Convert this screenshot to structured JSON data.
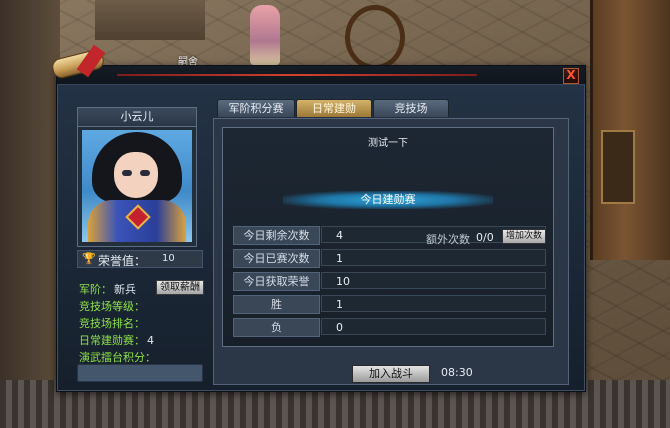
{
  "scene": {
    "npc_name": "嗣舍"
  },
  "window": {
    "close_label": "X"
  },
  "character": {
    "name": "小云儿",
    "honor_label": "荣誉值：",
    "honor_value": "10",
    "rank_label": "军阶：",
    "rank_value": "新兵",
    "claim_label": "领取薪酬",
    "arena_level_label": "竞技场等级：",
    "arena_rank_label": "竞技场排名：",
    "daily_label": "日常建勋赛：",
    "daily_value": "4",
    "drill_label": "演武擂台积分："
  },
  "tabs": [
    {
      "label": "军阶积分赛",
      "active": false
    },
    {
      "label": "日常建勋",
      "active": true
    },
    {
      "label": "竞技场",
      "active": false
    }
  ],
  "panel": {
    "header": "测试一下",
    "banner": "今日建勋赛",
    "rows": [
      {
        "label": "今日剩余次数",
        "value": "4"
      },
      {
        "label": "今日已赛次数",
        "value": "1"
      },
      {
        "label": "今日获取荣誉",
        "value": "10"
      },
      {
        "label": "胜",
        "value": "1"
      },
      {
        "label": "负",
        "value": "0"
      }
    ],
    "extra_label": "额外次数",
    "extra_value": "0/0",
    "add_label": "增加次数",
    "join_label": "加入战斗",
    "timer": "08:30"
  }
}
